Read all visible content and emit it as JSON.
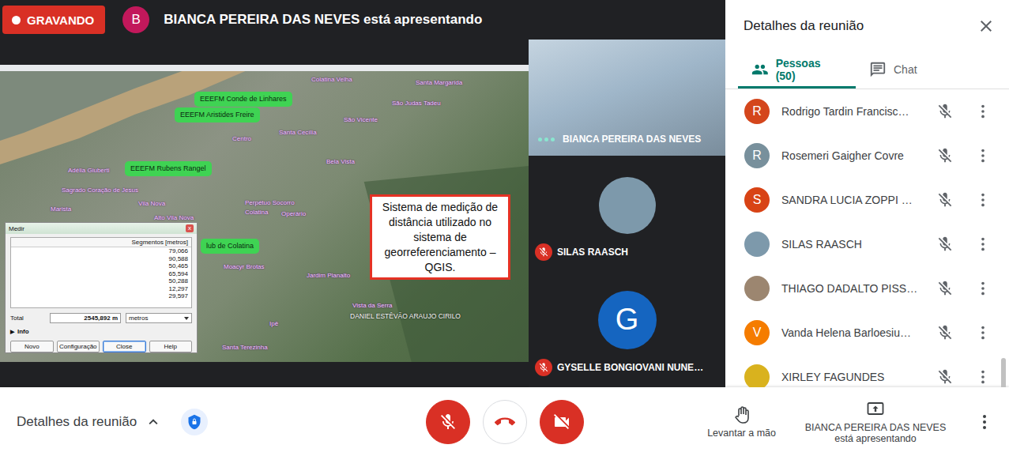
{
  "recording": {
    "label": "GRAVANDO"
  },
  "banner": {
    "avatar": "B",
    "text": "BIANCA PEREIRA DAS NEVES está apresentando"
  },
  "shared_screen": {
    "map_labels": [
      {
        "text": "Colatina Velha",
        "kind": "place"
      },
      {
        "text": "Santa Margarida",
        "kind": "place"
      },
      {
        "text": "São Judas Tadeu",
        "kind": "place"
      },
      {
        "text": "EEEFM Conde de Linhares",
        "kind": "school"
      },
      {
        "text": "EEEFM Aristides Freire",
        "kind": "school"
      },
      {
        "text": "São Vicente",
        "kind": "place"
      },
      {
        "text": "Santa Cecília",
        "kind": "place"
      },
      {
        "text": "Centro",
        "kind": "place"
      },
      {
        "text": "Adélia Giuberti",
        "kind": "place"
      },
      {
        "text": "EEEFM Rubens Rangel",
        "kind": "school"
      },
      {
        "text": "Bela Vista",
        "kind": "place"
      },
      {
        "text": "Sagrado Coração de Jesus",
        "kind": "place"
      },
      {
        "text": "Perpétuo Socorro",
        "kind": "place"
      },
      {
        "text": "Vila Nova",
        "kind": "place"
      },
      {
        "text": "Marista",
        "kind": "place"
      },
      {
        "text": "Colatina",
        "kind": "place"
      },
      {
        "text": "Operário",
        "kind": "place"
      },
      {
        "text": "Alto Vila Nova",
        "kind": "place"
      },
      {
        "text": "lub de Colatina",
        "kind": "school"
      },
      {
        "text": "Moacyr Brotas",
        "kind": "place"
      },
      {
        "text": "Jardim Planalto",
        "kind": "place"
      },
      {
        "text": "Vista da Serra",
        "kind": "place"
      },
      {
        "text": "DANIEL ESTÊVÃO ARAUJO CIRILO",
        "kind": "name"
      },
      {
        "text": "Ipê",
        "kind": "place"
      },
      {
        "text": "Santa Terezinha",
        "kind": "place"
      }
    ],
    "caption": "Sistema de medição de distância utilizado no sistema de georreferenciamento – QGIS.",
    "measure_dialog": {
      "title": "Medir",
      "close": "x",
      "column": "Segmentos [metros]",
      "segments": [
        "79,066",
        "90,588",
        "50,465",
        "65,594",
        "50,288",
        "12,297",
        "29,597"
      ],
      "total_label": "Total",
      "total": "2545,892 m",
      "unit": "metros",
      "expander": "▶",
      "info": "Info",
      "buttons": [
        {
          "label": "Novo",
          "selected": false
        },
        {
          "label": "Configuração",
          "selected": false
        },
        {
          "label": "Close",
          "selected": true
        },
        {
          "label": "Help",
          "selected": false
        }
      ]
    }
  },
  "tiles": [
    {
      "name": "BIANCA PEREIRA DAS NEVES",
      "kind": "video",
      "muted": false,
      "speaking": true
    },
    {
      "name": "SILAS RAASCH",
      "kind": "photo",
      "color": "#7d99ab",
      "muted": true,
      "speaking": false
    },
    {
      "name": "GYSELLE BONGIOVANI NUNE…",
      "kind": "letter",
      "avatar": "G",
      "color": "#1565c0",
      "muted": true,
      "speaking": false
    }
  ],
  "panel": {
    "title": "Detalhes da reunião",
    "tabs": [
      {
        "label": "Pessoas (50)",
        "selected": true
      },
      {
        "label": "Chat",
        "selected": false
      }
    ],
    "people": [
      {
        "name": "Rodrigo Tardin Francisc…",
        "kind": "letter",
        "avatar": "R",
        "color": "#d4461c",
        "muted": true
      },
      {
        "name": "Rosemeri Gaigher Covre",
        "kind": "letter",
        "avatar": "R",
        "color": "#78909c",
        "muted": true
      },
      {
        "name": "SANDRA LUCIA ZOPPI …",
        "kind": "letter",
        "avatar": "S",
        "color": "#d84315",
        "muted": true
      },
      {
        "name": "SILAS RAASCH",
        "kind": "photo",
        "color": "#7d99ab",
        "muted": true
      },
      {
        "name": "THIAGO DADALTO PISS…",
        "kind": "photo",
        "color": "#9c8670",
        "muted": true
      },
      {
        "name": "Vanda Helena Barloesiu…",
        "kind": "letter",
        "avatar": "V",
        "color": "#f57c00",
        "muted": true
      },
      {
        "name": "XIRLEY FAGUNDES",
        "kind": "photo",
        "color": "#d9b21e",
        "muted": true
      }
    ]
  },
  "bottom": {
    "details": "Detalhes da reunião",
    "mic_muted": true,
    "camera_off": true,
    "raise_hand": "Levantar a mão",
    "presenting": "BIANCA PEREIRA DAS NEVES está apresentando"
  }
}
